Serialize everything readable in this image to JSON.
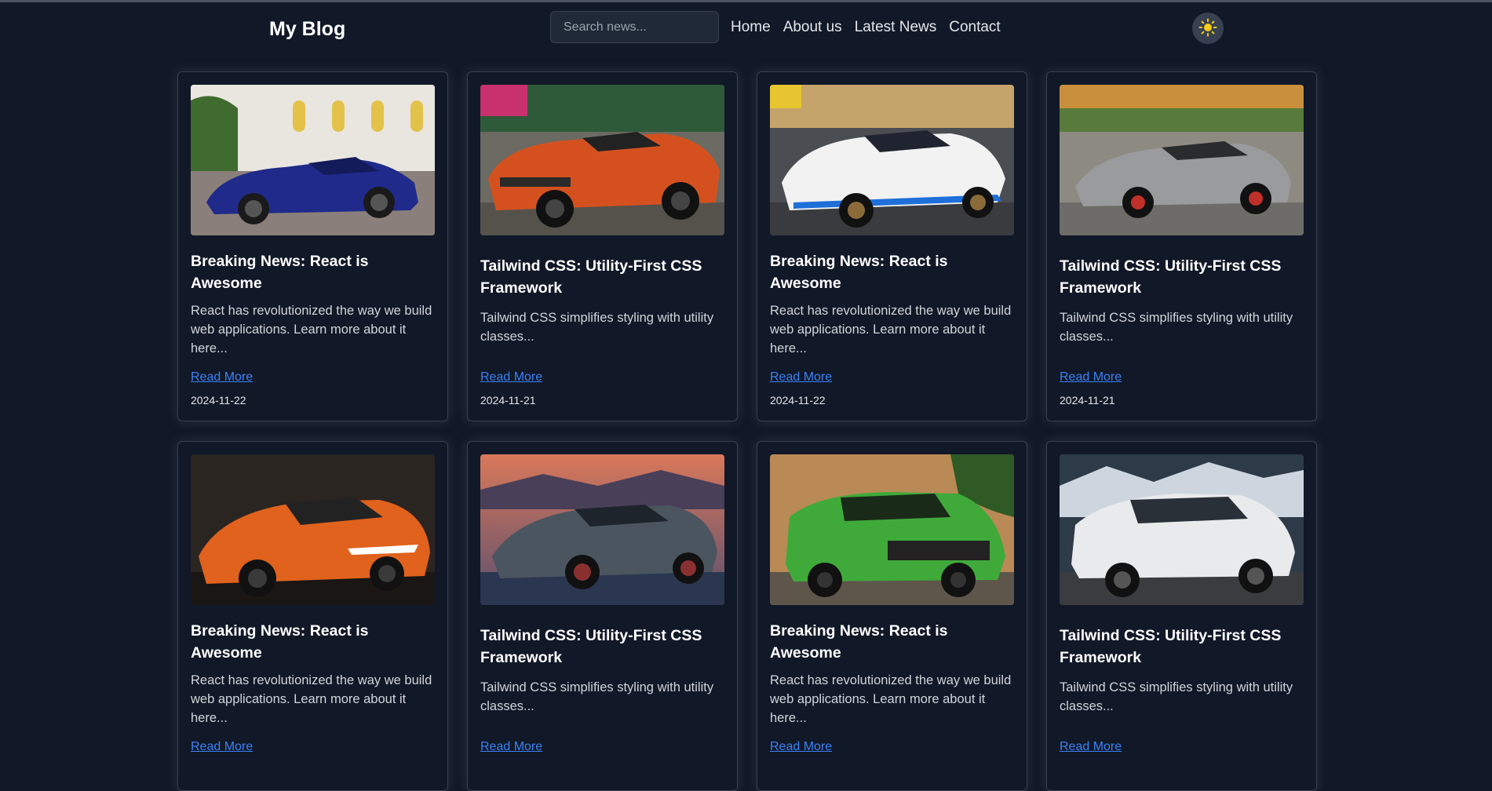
{
  "header": {
    "logo": "My Blog",
    "search_placeholder": "Search news...",
    "nav": [
      "Home",
      "About us",
      "Latest News",
      "Contact"
    ],
    "theme_icon": "sun-icon"
  },
  "colors": {
    "background": "#111827",
    "link": "#3b82f6",
    "sun": "#facc15"
  },
  "read_more": "Read More",
  "articles": [
    {
      "title": "Breaking News: React is Awesome",
      "summary": "React has revolutionized the way we build web applications. Learn more about it here...",
      "date": "2024-11-22",
      "image": "blue convertible sports car"
    },
    {
      "title": "Tailwind CSS: Utility-First CSS Framework",
      "summary": "Tailwind CSS simplifies styling with utility classes...",
      "date": "2024-11-21",
      "image": "orange rally sports car"
    },
    {
      "title": "Breaking News: React is Awesome",
      "summary": "React has revolutionized the way we build web applications. Learn more about it here...",
      "date": "2024-11-22",
      "image": "white race sports car"
    },
    {
      "title": "Tailwind CSS: Utility-First CSS Framework",
      "summary": "Tailwind CSS simplifies styling with utility classes...",
      "date": "2024-11-21",
      "image": "grey sports car"
    },
    {
      "title": "Breaking News: React is Awesome",
      "summary": "React has revolutionized the way we build web applications. Learn more about it here...",
      "date": "",
      "image": "orange hypercar"
    },
    {
      "title": "Tailwind CSS: Utility-First CSS Framework",
      "summary": "Tailwind CSS simplifies styling with utility classes...",
      "date": "",
      "image": "dark hypercar at sunset"
    },
    {
      "title": "Breaking News: React is Awesome",
      "summary": "React has revolutionized the way we build web applications. Learn more about it here...",
      "date": "",
      "image": "green SUV"
    },
    {
      "title": "Tailwind CSS: Utility-First CSS Framework",
      "summary": "Tailwind CSS simplifies styling with utility classes...",
      "date": "",
      "image": "white SUV"
    }
  ]
}
